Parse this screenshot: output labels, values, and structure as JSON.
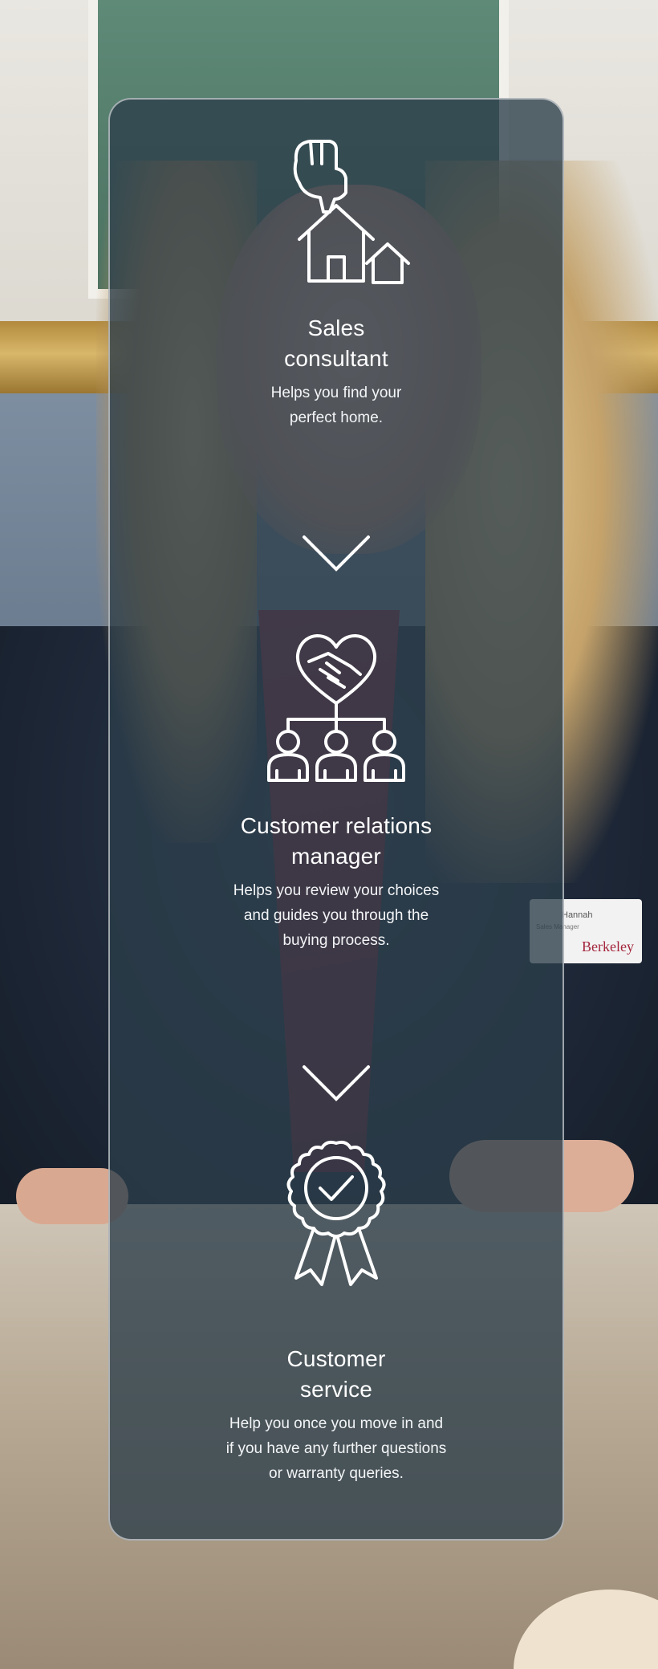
{
  "background": {
    "badge_name": "Hannah",
    "badge_role": "Sales Manager",
    "badge_brand": "Berkeley"
  },
  "steps": [
    {
      "icon": "pointing-hand-houses-icon",
      "title_line1": "Sales",
      "title_line2": "consultant",
      "desc_line1": "Helps you find your",
      "desc_line2": "perfect home."
    },
    {
      "icon": "handshake-heart-team-icon",
      "title_line1": "Customer relations",
      "title_line2": "manager",
      "desc_line1": "Helps you review your choices",
      "desc_line2": "and guides you through the",
      "desc_line3": "buying process."
    },
    {
      "icon": "award-rosette-check-icon",
      "title_line1": "Customer",
      "title_line2": "service",
      "desc_line1": "Help you once you move in and",
      "desc_line2": "if you have any further questions",
      "desc_line3": "or warranty queries."
    }
  ],
  "colors": {
    "panel": "#2c3e4a",
    "text": "#ffffff",
    "brand": "#a3253c"
  }
}
